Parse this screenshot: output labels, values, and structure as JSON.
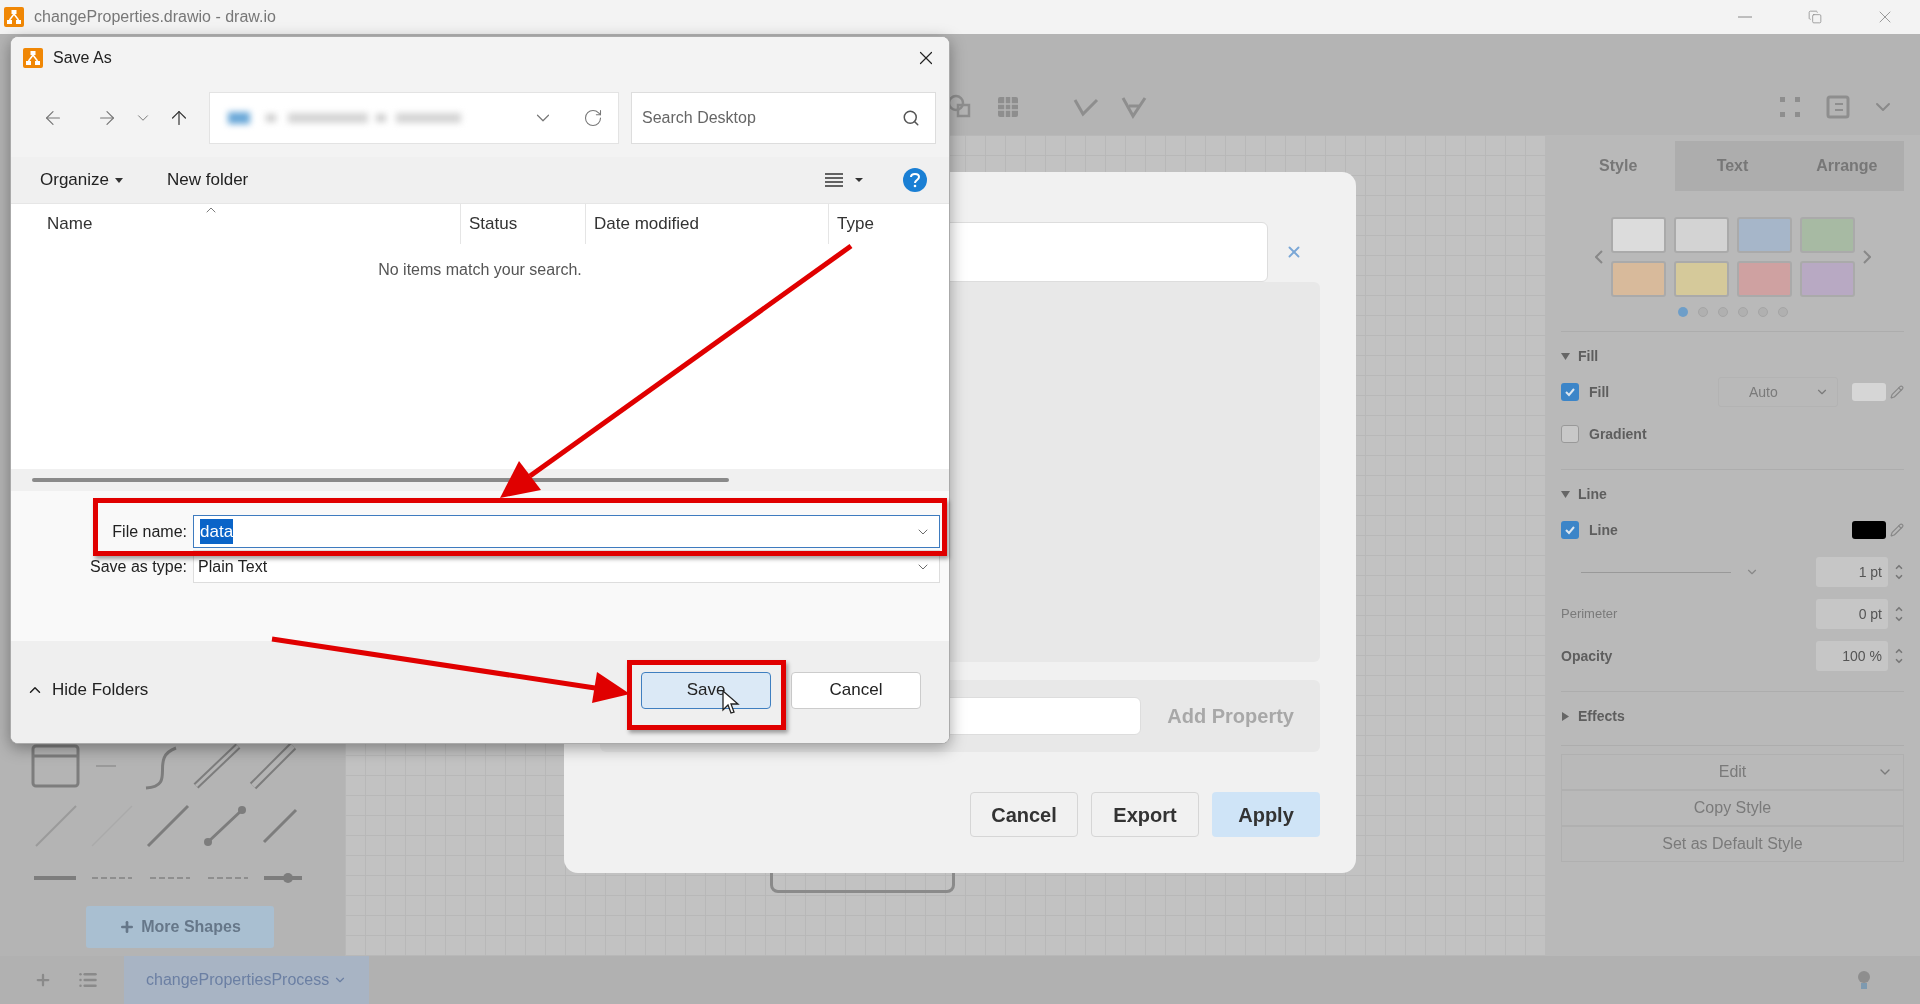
{
  "window": {
    "title": "changeProperties.drawio - draw.io"
  },
  "format_panel": {
    "tabs": [
      {
        "label": "Style",
        "selected": true
      },
      {
        "label": "Text",
        "selected": false
      },
      {
        "label": "Arrange",
        "selected": false
      }
    ],
    "swatches": [
      {
        "color": "#dcdcdc"
      },
      {
        "color": "#d3d3d3"
      },
      {
        "color": "#a6b6c9"
      },
      {
        "color": "#a7baa3"
      },
      {
        "color": "#d8ba9b"
      },
      {
        "color": "#d5c99a"
      },
      {
        "color": "#cfa1a1"
      },
      {
        "color": "#b8a9c3"
      }
    ],
    "pages": [
      {
        "selected": true
      },
      {
        "selected": false
      },
      {
        "selected": false
      },
      {
        "selected": false
      },
      {
        "selected": false
      },
      {
        "selected": false
      }
    ],
    "rows": [
      {
        "kind": "section",
        "label": "Fill",
        "expanded": true
      },
      {
        "kind": "check",
        "label": "Fill",
        "checked": true,
        "value": "Auto",
        "color": "#d6d6d6"
      },
      {
        "kind": "check",
        "label": "Gradient",
        "checked": false
      },
      {
        "kind": "section",
        "label": "Line",
        "expanded": true
      },
      {
        "kind": "check",
        "label": "Line",
        "checked": true,
        "color": "#000000"
      },
      {
        "kind": "stepper",
        "value": "1 pt"
      },
      {
        "kind": "stepper",
        "label": "Perimeter",
        "value": "0 pt",
        "bold": false
      },
      {
        "kind": "stepper",
        "label": "Opacity",
        "value": "100 %",
        "bold": true
      },
      {
        "kind": "section",
        "label": "Effects",
        "expanded": false
      }
    ],
    "buttons": [
      {
        "label": "Edit",
        "dropdown": true
      },
      {
        "label": "Copy Style",
        "dropdown": false
      },
      {
        "label": "Set as Default Style",
        "dropdown": false
      }
    ]
  },
  "sidebar": {
    "more_shapes": "More Shapes"
  },
  "page_tabs": [
    {
      "label": "changePropertiesProcess",
      "selected": true
    }
  ],
  "properties_dialog": {
    "add_property": {
      "label": "Add Property",
      "disabled": true
    },
    "buttons": [
      {
        "label": "Cancel",
        "kind": "plain"
      },
      {
        "label": "Export",
        "kind": "plain"
      },
      {
        "label": "Apply",
        "kind": "primary"
      }
    ]
  },
  "save_dialog": {
    "title": "Save As",
    "search": {
      "placeholder": "Search Desktop"
    },
    "organize": "Organize",
    "new_folder": "New folder",
    "columns": [
      "Name",
      "Status",
      "Date modified",
      "Type"
    ],
    "empty_message": "No items match your search.",
    "file_name": {
      "label": "File name:",
      "value": "data",
      "text_selected": true
    },
    "save_as_type": {
      "label": "Save as type:",
      "value": "Plain Text"
    },
    "hide_folders": "Hide Folders",
    "buttons": [
      {
        "label": "Save",
        "kind": "primary"
      },
      {
        "label": "Cancel",
        "kind": "secondary"
      }
    ]
  }
}
